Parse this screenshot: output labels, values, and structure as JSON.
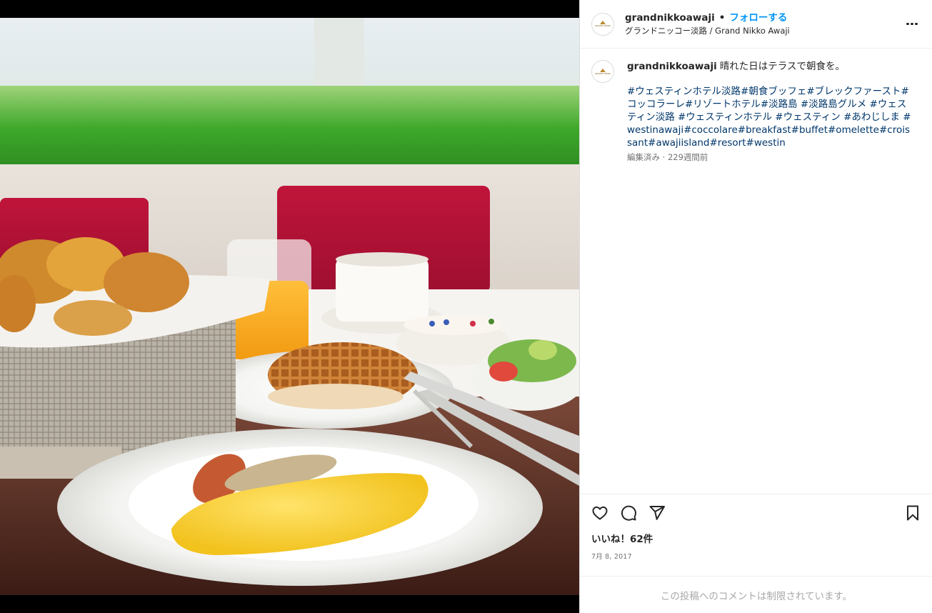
{
  "post": {
    "username": "grandnikkoawaji",
    "dot": "•",
    "follow_label": "フォローする",
    "location": "グランドニッコー淡路 / Grand Nikko Awaji",
    "avatar_text": "GRAND NIKKO",
    "caption_text": "晴れた日はテラスで朝食を。",
    "hashtags": [
      "#ウェスティンホテル淡路",
      "#朝食ブッフェ",
      "#ブレックファースト",
      "#コッコラーレ",
      "#リゾートホテル",
      "#淡路島 ",
      "#淡路島グルメ ",
      "#ウェスティン淡路 ",
      "#ウェスティンホテル ",
      "#ウェスティン ",
      "#あわじしま ",
      "#westinawaji",
      "#coccolare",
      "#breakfast",
      "#buffet",
      "#omelette",
      "#croissant",
      "#awajiisland",
      "#resort",
      "#westin"
    ],
    "caption_meta": "編集済み · 229週間前",
    "likes": "いいね！62件",
    "date": "7月 8, 2017",
    "comments_disabled": "この投稿へのコメントは制限されています。"
  },
  "icons": {
    "more": "more-options-icon",
    "like": "heart-icon",
    "comment": "comment-icon",
    "share": "send-icon",
    "save": "bookmark-icon"
  },
  "colors": {
    "follow": "#0095f6",
    "hashtag": "#00376b",
    "muted": "#737373",
    "border": "#efefef"
  }
}
